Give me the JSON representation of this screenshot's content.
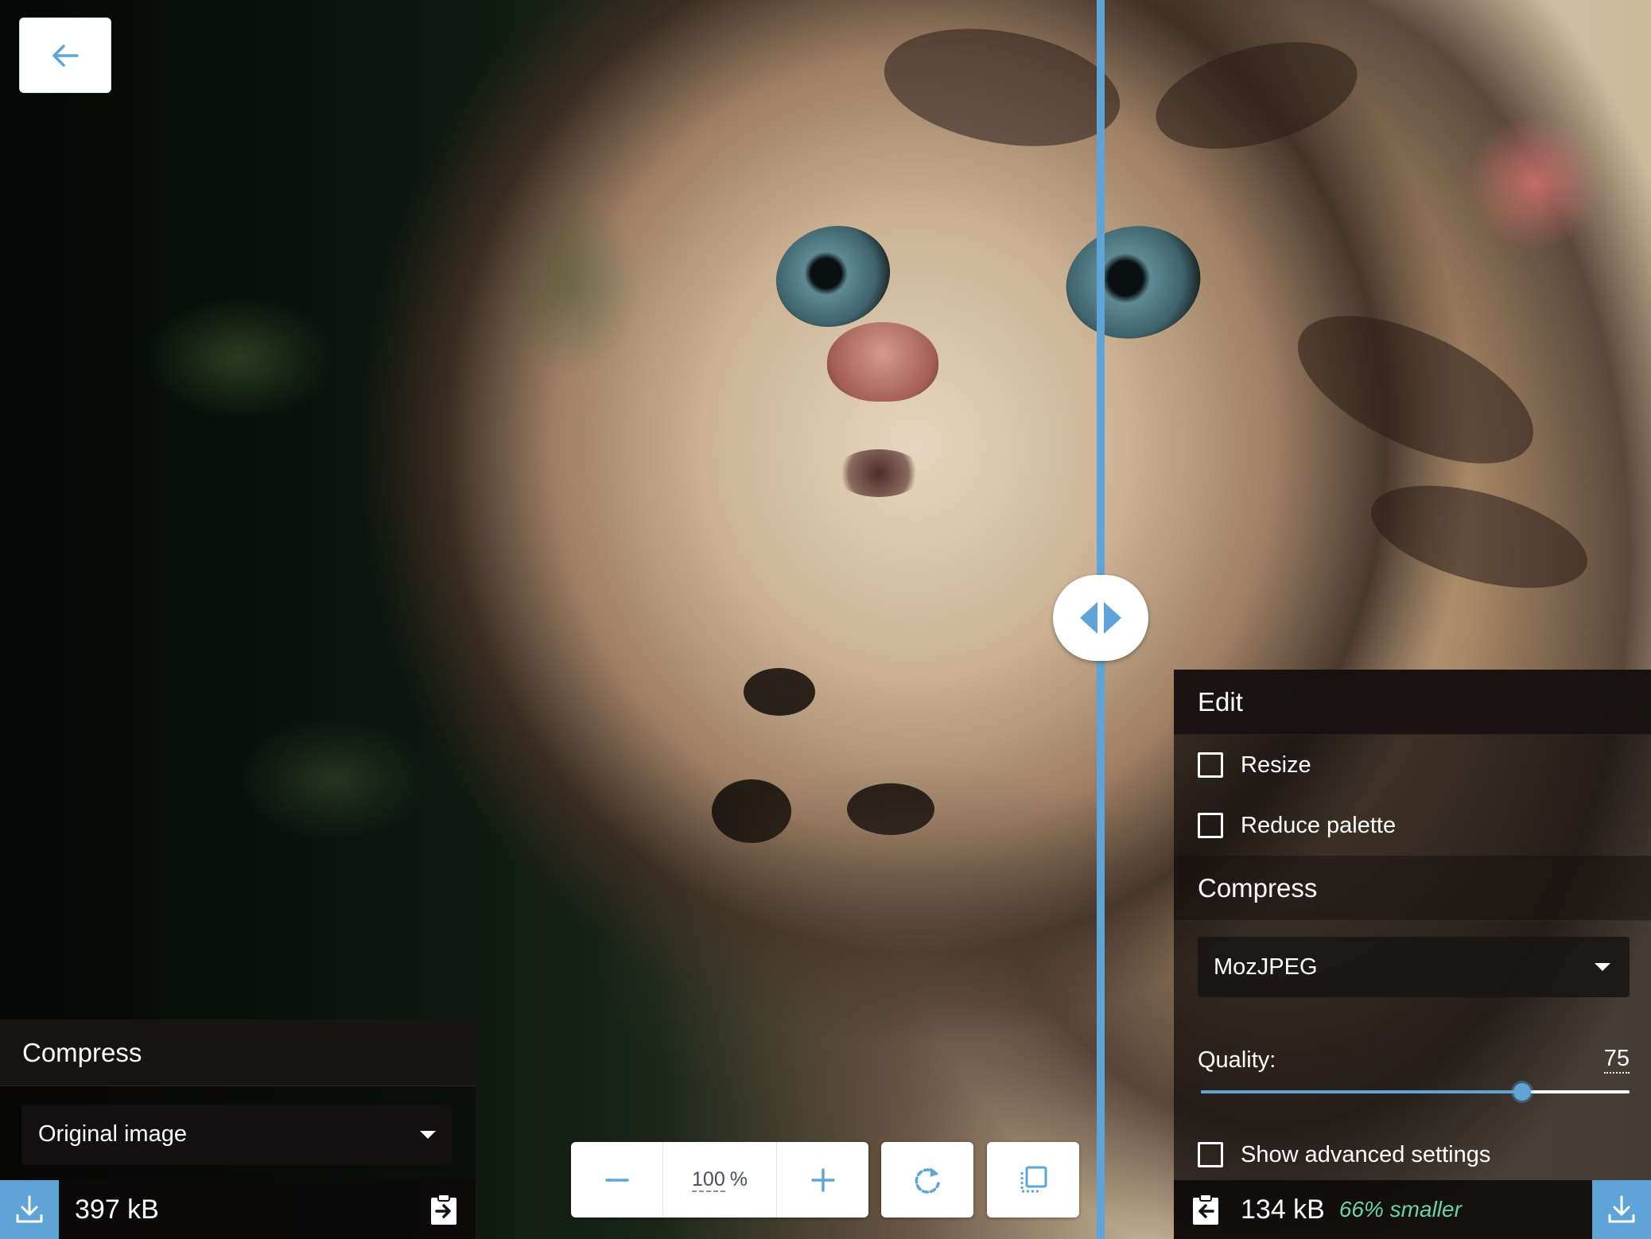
{
  "back_button": {
    "icon": "arrow-left-icon"
  },
  "left_panel": {
    "heading": "Compress",
    "selected_option": "Original image",
    "file_size": "397 kB"
  },
  "right_panel": {
    "edit_heading": "Edit",
    "resize_label": "Resize",
    "reduce_palette_label": "Reduce palette",
    "compress_heading": "Compress",
    "selected_codec": "MozJPEG",
    "quality_label": "Quality:",
    "quality_value": "75",
    "quality_level": 75,
    "advanced_label": "Show advanced settings",
    "file_size": "134 kB",
    "savings": "66% smaller"
  },
  "zoom": {
    "value": "100",
    "unit": "%"
  },
  "colors": {
    "accent": "#5fa4d7",
    "savings": "#6bd3a9"
  }
}
